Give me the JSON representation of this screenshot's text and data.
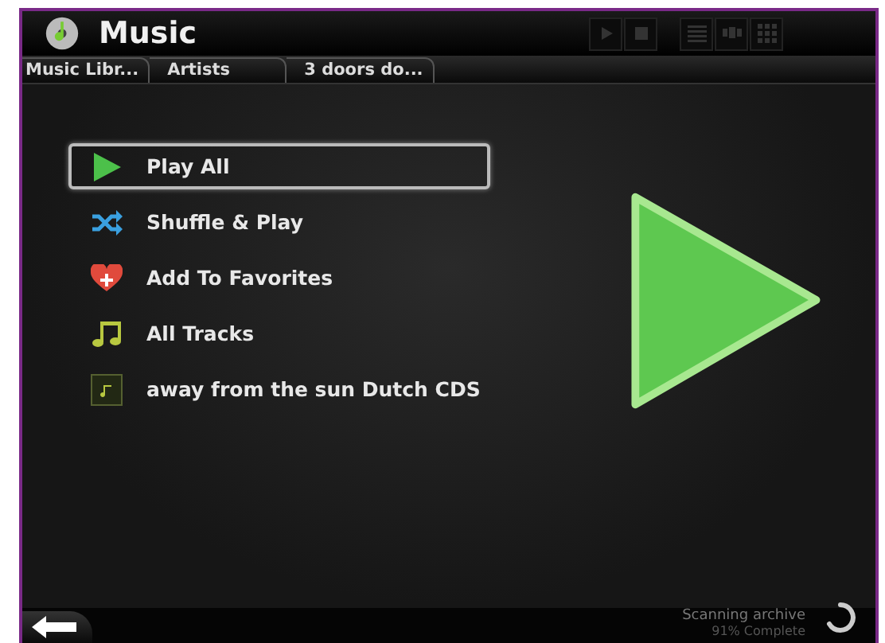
{
  "window": {
    "title": "Music"
  },
  "breadcrumbs": [
    {
      "label": "Music Libr..."
    },
    {
      "label": "Artists"
    },
    {
      "label": "3 doors do..."
    }
  ],
  "menu": [
    {
      "kind": "play",
      "label": "Play All",
      "selected": true
    },
    {
      "kind": "shuffle",
      "label": "Shuffle & Play",
      "selected": false
    },
    {
      "kind": "favorite",
      "label": "Add To Favorites",
      "selected": false
    },
    {
      "kind": "tracks",
      "label": "All Tracks",
      "selected": false
    },
    {
      "kind": "album",
      "label": "away from the sun Dutch CDS",
      "selected": false
    }
  ],
  "status": {
    "title": "Scanning archive",
    "detail": "91% Complete"
  }
}
